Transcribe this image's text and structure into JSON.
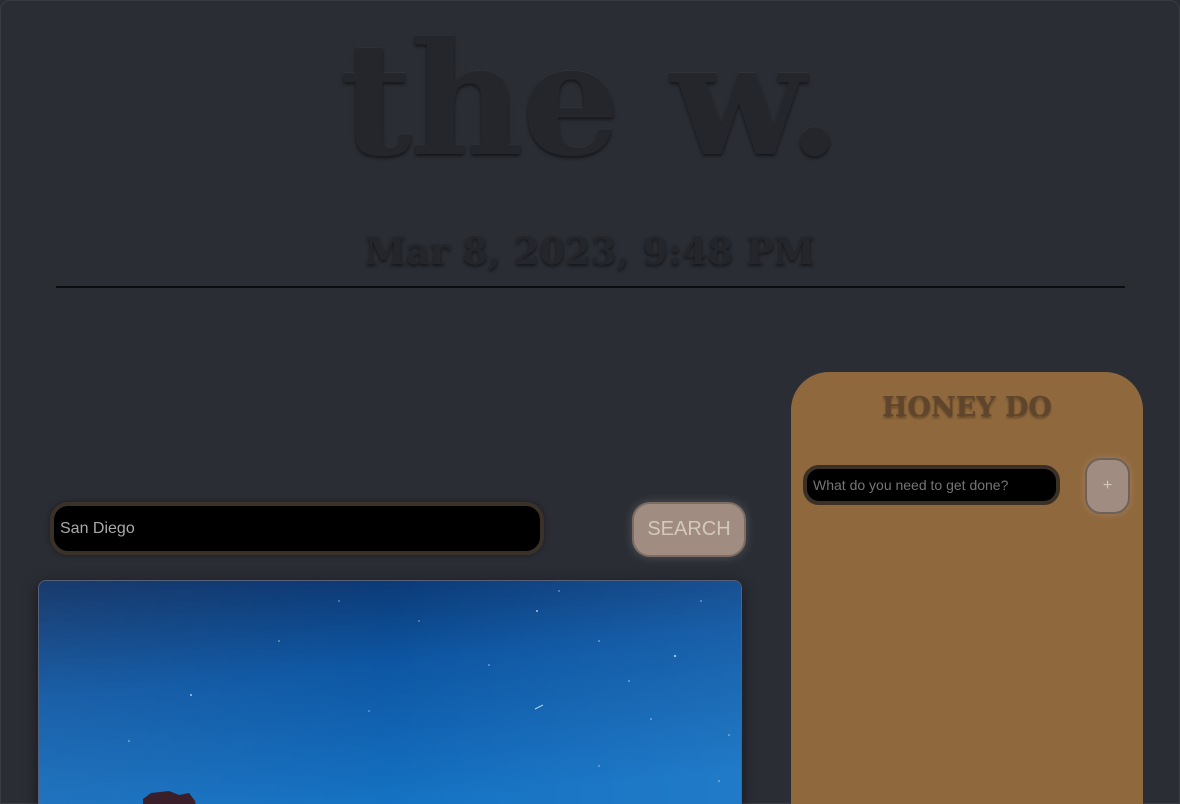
{
  "header": {
    "logo": "the w.",
    "datetime": "Mar 8, 2023, 9:48 PM"
  },
  "search": {
    "value": "San Diego",
    "button_label": "SEARCH"
  },
  "weather_image": {
    "description_icon": "night-sky-icon"
  },
  "todo": {
    "title": "HONEY DO",
    "placeholder": "What do you need to get done?",
    "add_label": "+"
  },
  "colors": {
    "background": "#2b2d35",
    "panel": "#90683d",
    "button": "#a08c80"
  }
}
